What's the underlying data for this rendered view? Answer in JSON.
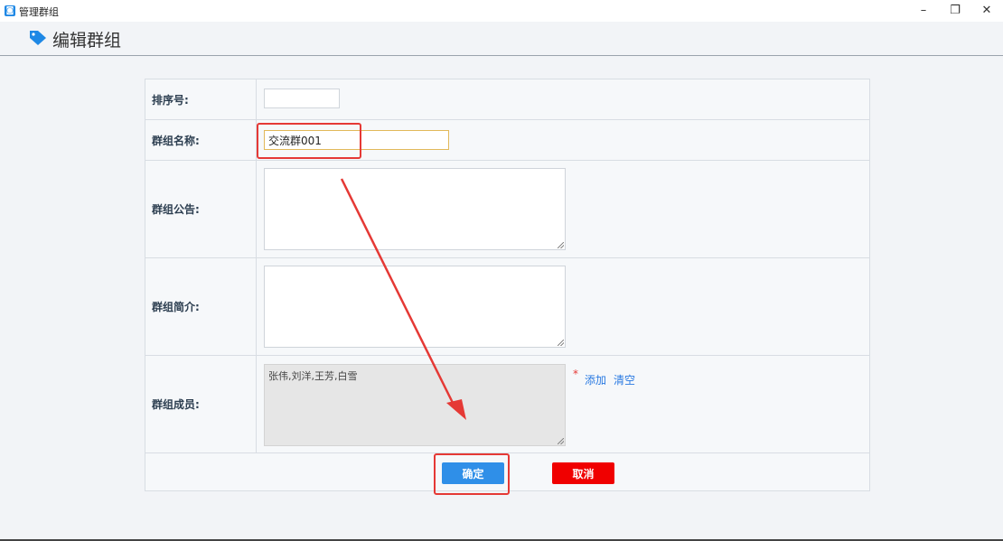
{
  "window": {
    "title": "管理群组",
    "app_icon_glyph": "◙",
    "controls": {
      "minimize": "–",
      "restore": "❐",
      "close": "✕"
    }
  },
  "header": {
    "title": "编辑群组",
    "icon": "tag-icon",
    "icon_color": "#1e88e5"
  },
  "form": {
    "sort_label": "排序号:",
    "sort_value": "",
    "name_label": "群组名称:",
    "name_value": "交流群001",
    "notice_label": "群组公告:",
    "notice_value": "",
    "intro_label": "群组简介:",
    "intro_value": "",
    "members_label": "群组成员:",
    "members_value": "张伟,刘洋,王芳,白雪",
    "required_mark": "*",
    "add_link": "添加",
    "clear_link": "清空"
  },
  "actions": {
    "confirm_label": "确定",
    "cancel_label": "取消",
    "confirm_color": "#2f8fe8",
    "cancel_color": "#f00000"
  },
  "annotations": {
    "highlight_color": "#e53935"
  }
}
